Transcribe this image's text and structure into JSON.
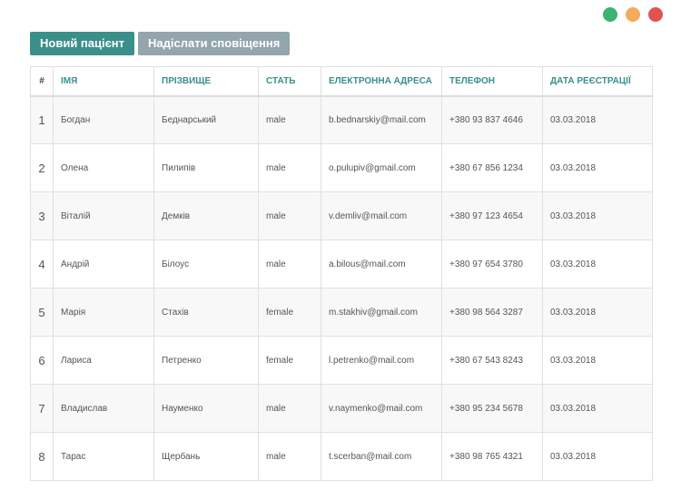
{
  "window_controls": [
    {
      "name": "maximize",
      "color": "#3cb371"
    },
    {
      "name": "minimize",
      "color": "#f5ab59"
    },
    {
      "name": "close",
      "color": "#e0534f"
    }
  ],
  "toolbar": {
    "new_patient_label": "Новий пацієнт",
    "send_notification_label": "Надіслати сповіщення"
  },
  "table": {
    "headers": [
      "#",
      "Імя",
      "Прізвище",
      "Стать",
      "Електронна адреса",
      "Телефон",
      "Дата реєстрації"
    ],
    "rows": [
      [
        "1",
        "Богдан",
        "Беднарський",
        "male",
        "b.bednarskiy@mail.com",
        "+380 93 837 4646",
        "03.03.2018"
      ],
      [
        "2",
        "Олена",
        "Пилипів",
        "male",
        "o.pulupiv@gmail.com",
        "+380 67 856 1234",
        "03.03.2018"
      ],
      [
        "3",
        "Віталій",
        "Демків",
        "male",
        "v.demliv@mail.com",
        "+380 97 123 4654",
        "03.03.2018"
      ],
      [
        "4",
        "Андрій",
        "Білоус",
        "male",
        "a.bilous@mail.com",
        "+380 97 654 3780",
        "03.03.2018"
      ],
      [
        "5",
        "Марія",
        "Стахів",
        "female",
        "m.stakhiv@gmail.com",
        "+380 98 564 3287",
        "03.03.2018"
      ],
      [
        "6",
        "Лариса",
        "Петренко",
        "female",
        "l.petrenko@mail.com",
        "+380 67 543 8243",
        "03.03.2018"
      ],
      [
        "7",
        "Владислав",
        "Науменко",
        "male",
        "v.naymenko@mail.com",
        "+380 95 234 5678",
        "03.03.2018"
      ],
      [
        "8",
        "Тарас",
        "Щербань",
        "male",
        "t.scerban@mail.com",
        "+380 98 765 4321",
        "03.03.2018"
      ]
    ]
  }
}
